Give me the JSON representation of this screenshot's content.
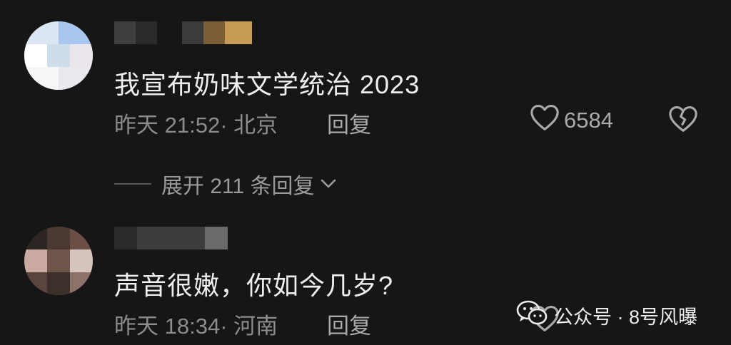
{
  "comments": [
    {
      "text": "我宣布奶味文学统治 2023",
      "time": "昨天 21:52· 北京",
      "reply_label": "回复",
      "likes": "6584"
    },
    {
      "text": "声音很嫩，你如今几岁?",
      "time": "昨天 18:34· 河南",
      "reply_label": "回复",
      "likes": ""
    }
  ],
  "expand_label": "展开 211 条回复",
  "watermark": {
    "text": "公众号 · 8号风曝"
  },
  "icons": {
    "like": "heart-outline-icon",
    "dislike": "broken-heart-icon",
    "expand": "chevron-down-icon",
    "watermark": "wechat-icon"
  },
  "colors": {
    "background": "#161616",
    "text": "#efefef",
    "meta": "#8c8c8c"
  }
}
